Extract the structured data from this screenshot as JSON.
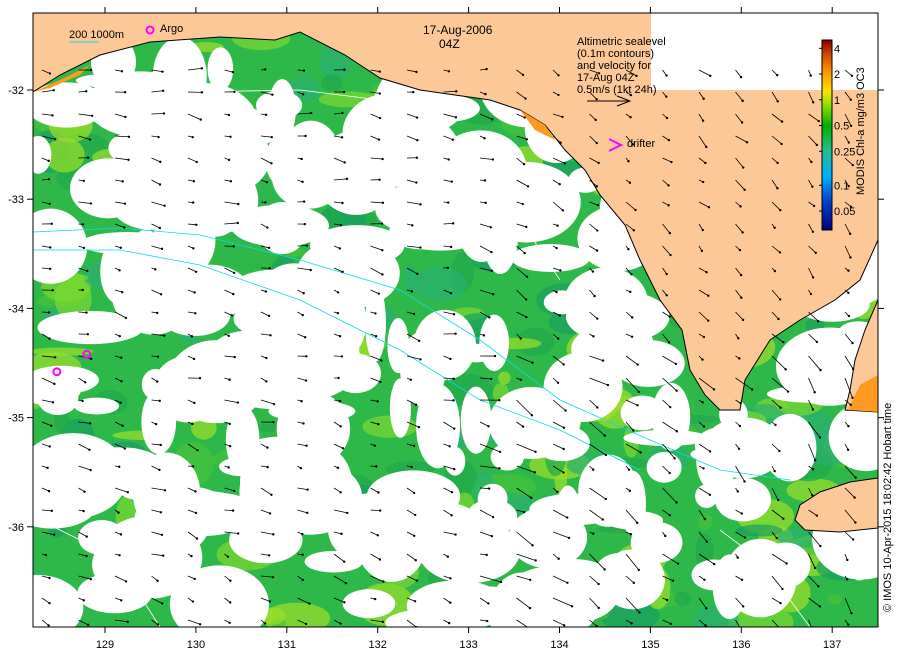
{
  "title": {
    "date": "17-Aug-2006",
    "time": "04Z"
  },
  "scale_legend": "200  1000m",
  "argo_label": "Argo",
  "velocity_legend": [
    "Altimetric sealevel",
    "(0.1m contours)",
    "and velocity for",
    "17-Aug 04Z",
    "0.5m/s (1kt 24h)"
  ],
  "drifter_label": "drifter",
  "colorbar": {
    "label": "MODIS Chl-a mg/m3 OC3",
    "ticks": [
      "4",
      "2",
      "1",
      "0.5",
      "0.25",
      "0.1",
      "0.05"
    ],
    "tick_values": [
      4,
      2,
      1,
      0.5,
      0.25,
      0.1,
      0.05
    ],
    "range": [
      0.03,
      5
    ],
    "colors": [
      "#00007f",
      "#0050e0",
      "#00c0ff",
      "#20c080",
      "#00b000",
      "#a0e000",
      "#ffe000",
      "#ff9000",
      "#d04000",
      "#800000"
    ]
  },
  "x_axis": {
    "ticks": [
      "129",
      "130",
      "131",
      "132",
      "133",
      "134",
      "135",
      "136",
      "137"
    ],
    "range": [
      128.21,
      137.5
    ]
  },
  "y_axis": {
    "ticks": [
      "-32",
      "-33",
      "-34",
      "-35",
      "-36"
    ],
    "range": [
      -31.3,
      -36.9
    ]
  },
  "argo_floats": [
    [
      128.8,
      -34.42
    ],
    [
      128.47,
      -34.58
    ]
  ],
  "credit": "© IMOS 10-Apr-2015 18:02:42 Hobart time",
  "colors": {
    "land": "#fdc898",
    "ocean_chl": "#22b03a",
    "cloud": "#ffffff",
    "argo": "#ff00ff",
    "drifter": "#ff00ff",
    "contour": "#ffffff",
    "isobath": "#00e0e0"
  }
}
